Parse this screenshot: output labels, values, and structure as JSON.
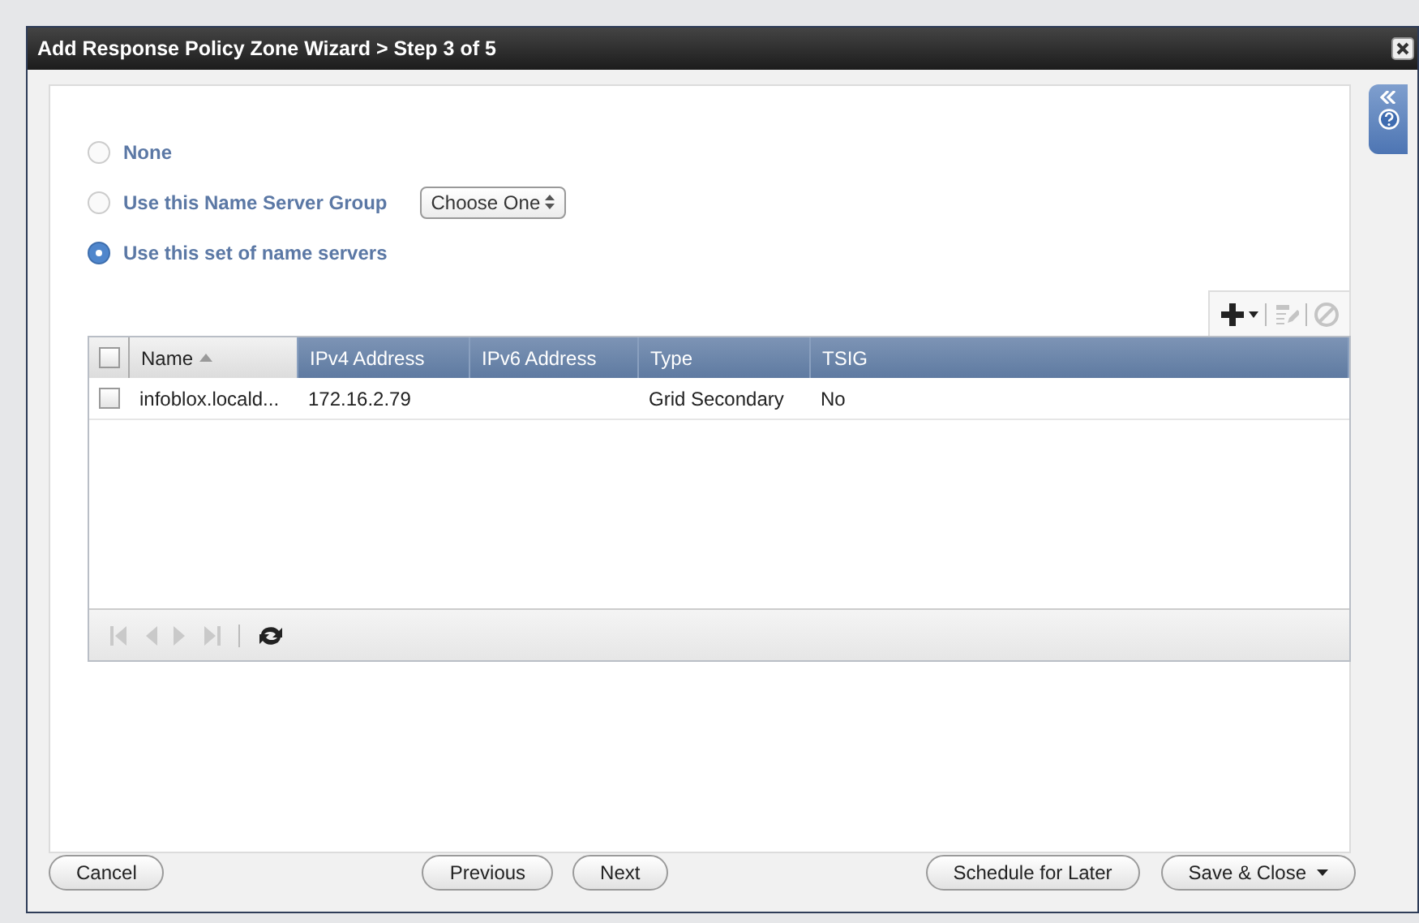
{
  "window": {
    "title": "Add Response Policy Zone Wizard > Step 3 of 5"
  },
  "options": [
    {
      "label": "None",
      "selected": false
    },
    {
      "label": "Use this Name Server Group",
      "selected": false,
      "dropdown": "Choose One"
    },
    {
      "label": "Use this set of name servers",
      "selected": true
    }
  ],
  "toolbar": [
    {
      "kind": "add",
      "disabled": false
    },
    {
      "kind": "edit",
      "disabled": true
    },
    {
      "kind": "delete",
      "disabled": true
    }
  ],
  "table": {
    "select_all": {
      "checked": false
    },
    "columns": [
      {
        "label": "Name",
        "sorted": true
      },
      {
        "label": "IPv4 Address",
        "sorted": false
      },
      {
        "label": "IPv6 Address",
        "sorted": false
      },
      {
        "label": "Type",
        "sorted": false
      },
      {
        "label": "TSIG",
        "sorted": false
      }
    ],
    "rows": [
      {
        "checked": false,
        "cells": [
          "infoblox.locald...",
          "172.16.2.79",
          "",
          "Grid Secondary",
          "No"
        ]
      }
    ]
  },
  "pager": [
    {
      "kind": "first",
      "disabled": true
    },
    {
      "kind": "prev",
      "disabled": true
    },
    {
      "kind": "next",
      "disabled": true
    },
    {
      "kind": "last",
      "disabled": true
    },
    {
      "kind": "refresh",
      "disabled": false
    }
  ],
  "buttons": [
    {
      "label": "Cancel",
      "kind": "plain"
    },
    {
      "label": "Previous",
      "kind": "plain"
    },
    {
      "label": "Next",
      "kind": "plain"
    },
    {
      "label": "Schedule for Later",
      "kind": "plain"
    },
    {
      "label": "Save & Close",
      "kind": "menu"
    }
  ]
}
